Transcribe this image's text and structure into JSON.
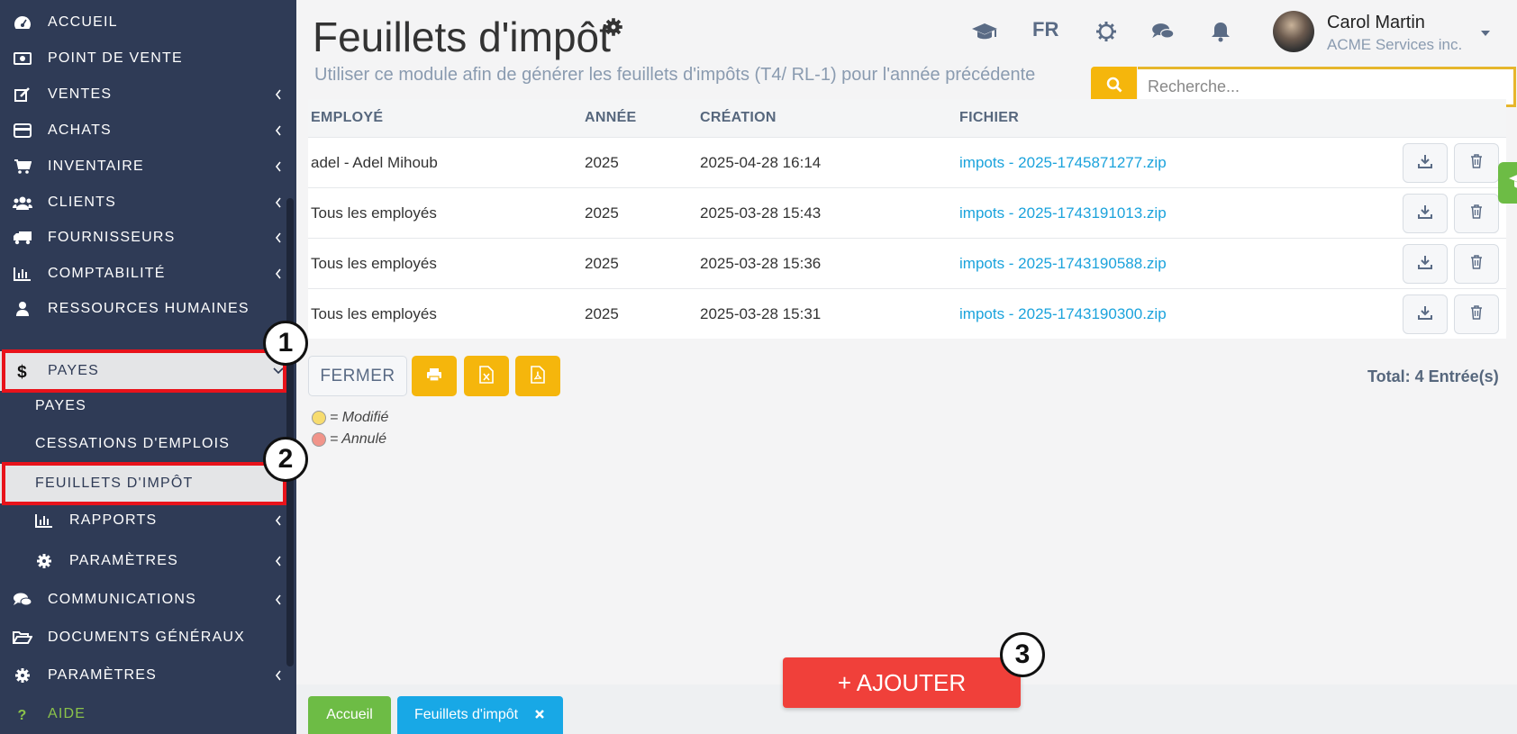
{
  "sidebar": {
    "items": [
      {
        "label": "ACCUEIL",
        "icon": "dashboard-icon"
      },
      {
        "label": "POINT DE VENTE",
        "icon": "money-icon"
      },
      {
        "label": "VENTES",
        "icon": "edit-icon"
      },
      {
        "label": "ACHATS",
        "icon": "credit-card-icon"
      },
      {
        "label": "INVENTAIRE",
        "icon": "cart-icon"
      },
      {
        "label": "CLIENTS",
        "icon": "users-icon"
      },
      {
        "label": "FOURNISSEURS",
        "icon": "truck-icon"
      },
      {
        "label": "COMPTABILITÉ",
        "icon": "bar-chart-icon"
      },
      {
        "label": "RESSOURCES HUMAINES",
        "icon": "user-icon"
      },
      {
        "label": "PAYES",
        "icon": "dollar-icon"
      },
      {
        "label": "PAYES"
      },
      {
        "label": "CESSATIONS D'EMPLOIS"
      },
      {
        "label": "FEUILLETS D'IMPÔT"
      },
      {
        "label": "RAPPORTS",
        "icon": "bar-chart-icon"
      },
      {
        "label": "PARAMÈTRES",
        "icon": "gear-icon"
      },
      {
        "label": "COMMUNICATIONS",
        "icon": "comments-icon"
      },
      {
        "label": "DOCUMENTS GÉNÉRAUX",
        "icon": "folder-open-icon"
      },
      {
        "label": "PARAMÈTRES",
        "icon": "gear-icon"
      },
      {
        "label": "AIDE",
        "icon": "question-icon"
      }
    ]
  },
  "markers": [
    "1",
    "2",
    "3"
  ],
  "header": {
    "title": "Feuillets d'impôt",
    "subtitle": "Utiliser ce module afin de générer les feuillets d'impôts (T4/ RL-1) pour l'année précédente",
    "language": "FR",
    "user_name": "Carol Martin",
    "company": "ACME Services inc."
  },
  "search": {
    "placeholder": "Recherche..."
  },
  "table": {
    "columns": [
      "EMPLOYÉ",
      "ANNÉE",
      "CRÉATION",
      "FICHIER"
    ],
    "rows": [
      {
        "employee": "adel - Adel Mihoub",
        "year": "2025",
        "created": "2025-04-28 16:14",
        "file": "impots - 2025-1745871277.zip"
      },
      {
        "employee": "Tous les employés",
        "year": "2025",
        "created": "2025-03-28 15:43",
        "file": "impots - 2025-1743191013.zip"
      },
      {
        "employee": "Tous les employés",
        "year": "2025",
        "created": "2025-03-28 15:36",
        "file": "impots - 2025-1743190588.zip"
      },
      {
        "employee": "Tous les employés",
        "year": "2025",
        "created": "2025-03-28 15:31",
        "file": "impots - 2025-1743190300.zip"
      }
    ]
  },
  "footer": {
    "close_label": "FERMER",
    "total": "Total: 4 Entrée(s)",
    "legend": [
      {
        "label": "= Modifié",
        "color": "#f7dc6f"
      },
      {
        "label": "= Annulé",
        "color": "#f1948a"
      }
    ]
  },
  "bottom_tabs": {
    "home": "Accueil",
    "current": "Feuillets d'impôt"
  },
  "add_button": "+ AJOUTER",
  "colors": {
    "sidebar_bg": "#2f3b56",
    "accent_yellow": "#f5b60c",
    "link_blue": "#1ba3dc",
    "add_red": "#f0403a",
    "green": "#6dbc45",
    "highlight_red": "#e8131b"
  }
}
